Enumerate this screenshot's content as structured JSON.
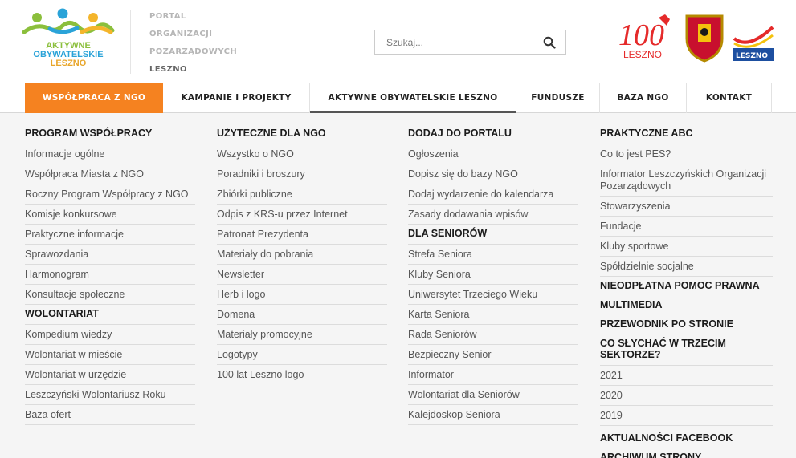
{
  "logo": {
    "line1": "AKTYWNE",
    "line2": "OBYWATELSKIE",
    "line3": "LESZNO"
  },
  "portal": {
    "l1": "PORTAL",
    "l2": "ORGANIZACJI",
    "l3": "POZARZĄDOWYCH",
    "l4": "LESZNO"
  },
  "search": {
    "placeholder": "Szukaj..."
  },
  "partners": {
    "p100_text": "LESZNO",
    "pleszno_text": "LESZNO"
  },
  "nav": [
    {
      "label": "WSPÓŁPRACA Z NGO"
    },
    {
      "label": "KAMPANIE I PROJEKTY"
    },
    {
      "label": "AKTYWNE OBYWATELSKIE LESZNO"
    },
    {
      "label": "FUNDUSZE"
    },
    {
      "label": "BAZA NGO"
    },
    {
      "label": "KONTAKT"
    }
  ],
  "colors": {
    "accent": "#f58220",
    "text": "#555555",
    "heading": "#1b1b1b"
  },
  "menu": {
    "col1": {
      "h1": "PROGRAM WSPÓŁPRACY",
      "items1": [
        "Informacje ogólne",
        "Współpraca Miasta z NGO",
        "Roczny Program Współpracy z NGO",
        "Komisje konkursowe",
        "Praktyczne informacje",
        "Sprawozdania",
        "Harmonogram",
        "Konsultacje społeczne"
      ],
      "h2": "WOLONTARIAT",
      "items2": [
        "Kompedium wiedzy",
        "Wolontariat w mieście",
        "Wolontariat w urzędzie",
        "Leszczyński Wolontariusz Roku",
        "Baza ofert"
      ]
    },
    "col2": {
      "h1": "UŻYTECZNE DLA NGO",
      "items1": [
        "Wszystko o NGO",
        "Poradniki i broszury",
        "Zbiórki publiczne",
        "Odpis z KRS-u przez Internet",
        "Patronat Prezydenta",
        "Materiały do pobrania",
        "Newsletter",
        "Herb i logo",
        "Domena",
        "Materiały promocyjne",
        "Logotypy",
        "100 lat Leszno logo"
      ]
    },
    "col3": {
      "h1": "DODAJ DO PORTALU",
      "items1": [
        "Ogłoszenia",
        "Dopisz się do bazy NGO",
        "Dodaj wydarzenie do kalendarza",
        "Zasady dodawania wpisów"
      ],
      "h2": "DLA SENIORÓW",
      "items2": [
        "Strefa Seniora",
        "Kluby Seniora",
        "Uniwersytet Trzeciego Wieku",
        "Karta Seniora",
        "Rada Seniorów",
        "Bezpieczny Senior",
        "Informator",
        "Wolontariat dla Seniorów",
        "Kalejdoskop Seniora"
      ]
    },
    "col4": {
      "h1": "PRAKTYCZNE ABC",
      "items1": [
        "Co to jest PES?",
        "Informator Leszczyńskich Organizacji Pozarządowych",
        "Stowarzyszenia",
        "Fundacje",
        "Kluby sportowe",
        "Spółdzielnie socjalne"
      ],
      "h2": "NIEODPŁATNA POMOC PRAWNA",
      "h3": "MULTIMEDIA",
      "h4": "PRZEWODNIK PO STRONIE",
      "h5": "CO SŁYCHAĆ W TRZECIM SEKTORZE?",
      "items5": [
        "2021",
        "2020",
        "2019"
      ],
      "h6": "AKTUALNOŚCI FACEBOOK",
      "h7": "ARCHIWUM STRONY"
    }
  }
}
